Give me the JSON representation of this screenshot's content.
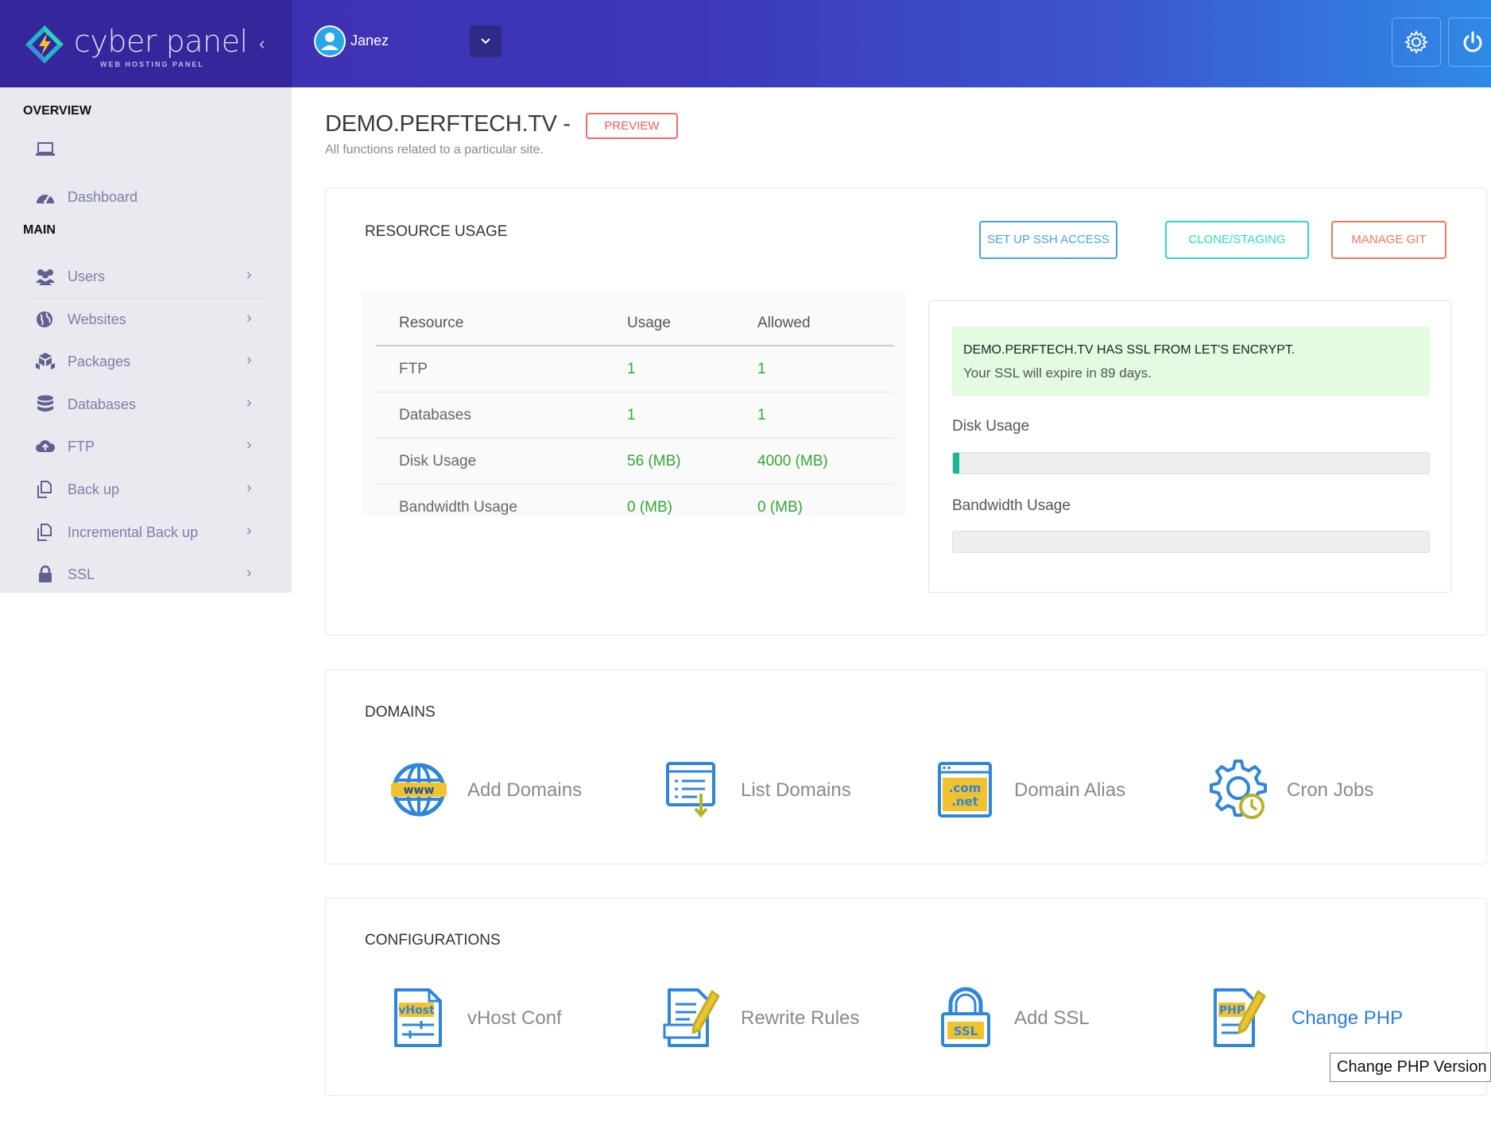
{
  "brand": {
    "name": "cyber panel",
    "tagline": "WEB HOSTING PANEL"
  },
  "header": {
    "user_name": "Janez",
    "settings_icon": "gear-icon",
    "power_icon": "power-icon"
  },
  "sidebar": {
    "overview_heading": "OVERVIEW",
    "dashboard_label": "Dashboard",
    "main_heading": "MAIN",
    "items": [
      {
        "label": "Users",
        "icon": "users-icon"
      },
      {
        "label": "Websites",
        "icon": "globe-icon"
      },
      {
        "label": "Packages",
        "icon": "packages-icon"
      },
      {
        "label": "Databases",
        "icon": "database-icon"
      },
      {
        "label": "FTP",
        "icon": "cloud-upload-icon"
      },
      {
        "label": "Back up",
        "icon": "copy-icon"
      },
      {
        "label": "Incremental Back up",
        "icon": "copy-icon"
      },
      {
        "label": "SSL",
        "icon": "lock-icon"
      }
    ]
  },
  "page": {
    "title": "DEMO.PERFTECH.TV -",
    "badge": "PREVIEW",
    "subtitle": "All functions related to a particular site."
  },
  "resource_usage": {
    "title": "RESOURCE USAGE",
    "buttons": {
      "ssh": "SET UP SSH ACCESS",
      "clone": "CLONE/STAGING",
      "git": "MANAGE GIT"
    },
    "table": {
      "headers": [
        "Resource",
        "Usage",
        "Allowed"
      ],
      "rows": [
        [
          "FTP",
          "1",
          "1"
        ],
        [
          "Databases",
          "1",
          "1"
        ],
        [
          "Disk Usage",
          "56 (MB)",
          "4000 (MB)"
        ],
        [
          "Bandwidth Usage",
          "0 (MB)",
          "0 (MB)"
        ]
      ]
    },
    "ssl_notice": {
      "line1": "DEMO.PERFTECH.TV HAS SSL FROM LET'S ENCRYPT.",
      "line2": "Your SSL will expire in 89 days."
    },
    "disk_label": "Disk Usage",
    "disk_percent": 1.4,
    "bandwidth_label": "Bandwidth Usage",
    "bandwidth_percent": 0
  },
  "domains": {
    "title": "DOMAINS",
    "tiles": [
      {
        "label": "Add Domains",
        "icon": "www-globe-icon"
      },
      {
        "label": "List Domains",
        "icon": "list-domains-icon"
      },
      {
        "label": "Domain Alias",
        "icon": "domain-alias-icon"
      },
      {
        "label": "Cron Jobs",
        "icon": "cron-gear-icon"
      }
    ]
  },
  "configurations": {
    "title": "CONFIGURATIONS",
    "tiles": [
      {
        "label": "vHost Conf",
        "icon": "vhost-file-icon"
      },
      {
        "label": "Rewrite Rules",
        "icon": "rewrite-rules-icon"
      },
      {
        "label": "Add SSL",
        "icon": "ssl-lock-icon"
      },
      {
        "label": "Change PHP",
        "icon": "php-file-icon"
      }
    ]
  },
  "tooltip": "Change PHP Version",
  "colors": {
    "header_start": "#3f2fb1",
    "header_end": "#2f8ae6",
    "success_green": "#34a634",
    "ssh_blue": "#4a9ff0",
    "clone_teal": "#2fd8b8",
    "git_orange": "#f2785a",
    "preview_red": "#ef5d5d",
    "link_blue": "#2b7fd6"
  }
}
